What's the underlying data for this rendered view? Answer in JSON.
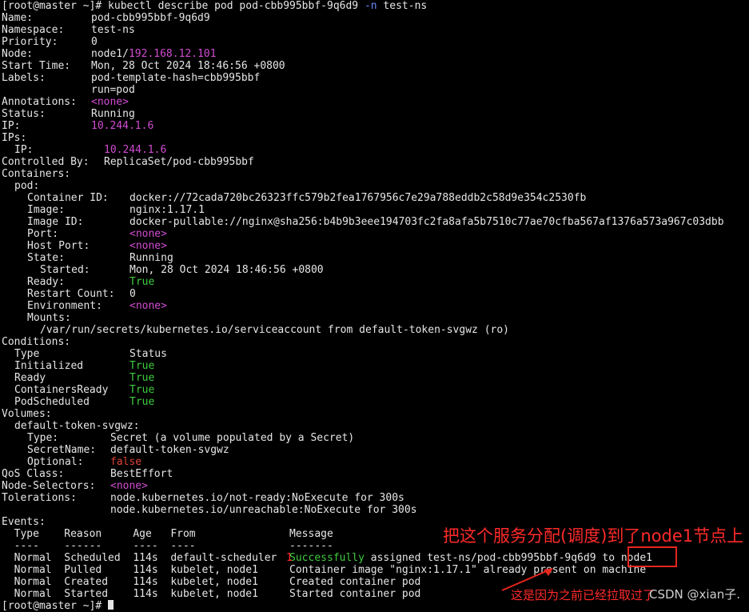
{
  "terminal": {
    "cmd_prefix": "[root@master ~]# kubectl describe pod pod-cbb995bbf-9q6d9 ",
    "cmd_flag": "-n",
    "cmd_suffix": " test-ns",
    "name_label": "Name:",
    "name_val": "pod-cbb995bbf-9q6d9",
    "ns_label": "Namespace:",
    "ns_val": "test-ns",
    "prio_label": "Priority:",
    "prio_val": "0",
    "node_label": "Node:",
    "node_val": "node1/",
    "node_ip": "192.168.12.101",
    "start_label": "Start Time:",
    "start_val": "Mon, 28 Oct 2024 18:46:56 +0800",
    "labels_label": "Labels:",
    "labels_val1": "pod-template-hash=cbb995bbf",
    "labels_val2": "run=pod",
    "annot_label": "Annotations:",
    "none": "<none>",
    "status_label": "Status:",
    "status_val": "Running",
    "ip_label": "IP:",
    "pod_ip": "10.244.1.6",
    "ips_label": "IPs:",
    "ips_ip_label": "IP:",
    "ctrl_label": "Controlled By:",
    "ctrl_val": "ReplicaSet/pod-cbb995bbf",
    "containers_label": "Containers:",
    "pod_label": "pod:",
    "cid_label": "Container ID:",
    "cid_val": "docker://72cada720bc26323ffc579b2fea1767956c7e29a788eddb2c58d9e354c2530fb",
    "image_label": "Image:",
    "image_val": "nginx:1.17.1",
    "imageid_label": "Image ID:",
    "imageid_val": "docker-pullable://nginx@sha256:b4b9b3eee194703fc2fa8afa5b7510c77ae70cfba567af1376a573a967c03dbb",
    "port_label": "Port:",
    "hostport_label": "Host Port:",
    "state_label": "State:",
    "state_val": "Running",
    "started_label": "Started:",
    "started_val": "Mon, 28 Oct 2024 18:46:56 +0800",
    "ready_label": "Ready:",
    "true": "True",
    "restart_label": "Restart Count:",
    "restart_val": "0",
    "env_label": "Environment:",
    "mounts_label": "Mounts:",
    "mount_val": "/var/run/secrets/kubernetes.io/serviceaccount from default-token-svgwz (ro)",
    "conditions_label": "Conditions:",
    "cond_type_hdr": "Type",
    "cond_status_hdr": "Status",
    "cond_initialized": "Initialized",
    "cond_ready": "Ready",
    "cond_containers_ready": "ContainersReady",
    "cond_pod_scheduled": "PodScheduled",
    "volumes_label": "Volumes:",
    "vol_name": "default-token-svgwz:",
    "vol_type_label": "Type:",
    "vol_type_val": "Secret (a volume populated by a Secret)",
    "vol_secret_label": "SecretName:",
    "vol_secret_val": "default-token-svgwz",
    "vol_optional_label": "Optional:",
    "false": "false",
    "qos_label": "QoS Class:",
    "qos_val": "BestEffort",
    "nodesel_label": "Node-Selectors:",
    "tol_label": "Tolerations:",
    "tol_val1": "node.kubernetes.io/not-ready:NoExecute for 300s",
    "tol_val2": "node.kubernetes.io/unreachable:NoExecute for 300s",
    "events_label": "Events:",
    "ev_hdr": "  Type    Reason     Age   From               Message",
    "ev_sep": "  ----    ------     ----  ----               -------",
    "ev1_prefix": "  Normal  Scheduled  114s  default-scheduler  ",
    "ev1_success": "Successfully",
    "ev1_rest": " assigned test-ns/pod-cbb995bbf-9q6d9 to node1",
    "ev2": "  Normal  Pulled     114s  kubelet, node1     Container image \"nginx:1.17.1\" already present on machine",
    "ev3": "  Normal  Created    114s  kubelet, node1     Created container pod",
    "ev4": "  Normal  Started    114s  kubelet, node1     Started container pod",
    "prompt_end": "[root@master ~]# "
  },
  "annotations": {
    "top_note": "把这个服务分配(调度)到了node1节点上",
    "marker": "1",
    "bottom_note": "这是因为之前已经拉取过了"
  },
  "watermark": "CSDN @xian子."
}
